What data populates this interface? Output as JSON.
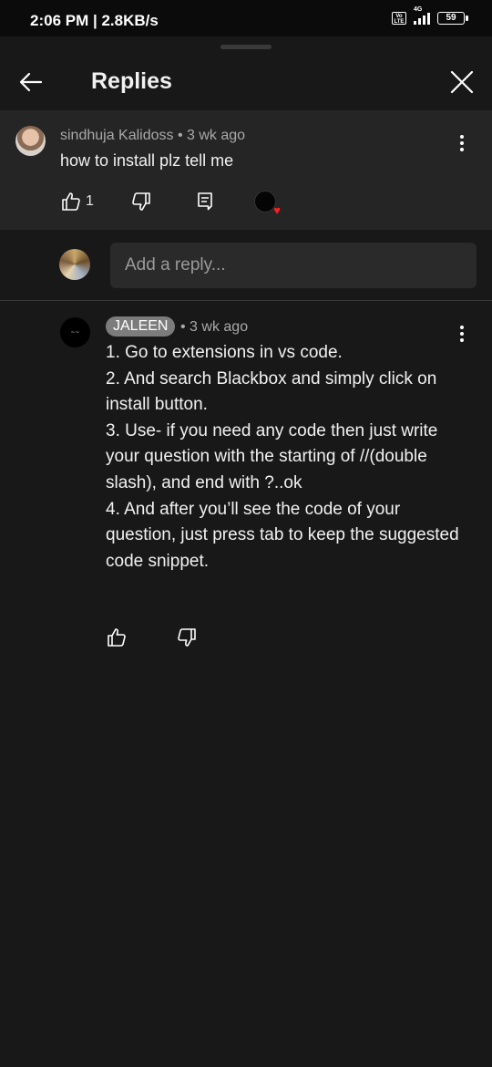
{
  "status_bar": {
    "time": "2:06 PM | 2.8KB/s",
    "volte": "Vo LTE",
    "network": "4G",
    "battery": "59"
  },
  "header": {
    "title": "Replies",
    "back_icon": "arrow-back-icon",
    "close_icon": "close-icon"
  },
  "parent_comment": {
    "author": "sindhuja Kalidoss",
    "time": "3 wk ago",
    "text": "how to install plz tell me",
    "like_count": "1",
    "creator_heart": true
  },
  "reply_box": {
    "placeholder": "Add a reply..."
  },
  "reply": {
    "author": "JALEEN",
    "time": "3 wk ago",
    "lines": [
      "1. Go to extensions in vs code.",
      "2. And search Blackbox and simply click on install button.",
      "3. Use- if you need any code then just write your question with the starting of //(double slash), and end with ?..ok",
      "4. And after you’ll see the code of your question, just press tab to keep the suggested code snippet."
    ]
  },
  "colors": {
    "background": "#181818",
    "parent_background": "#252525",
    "chip": "#7c7c7c",
    "heart": "#ff1f1f"
  }
}
